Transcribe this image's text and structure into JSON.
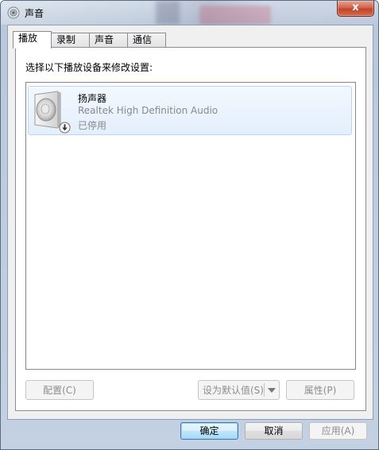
{
  "window": {
    "title": "声音",
    "close_label": "x"
  },
  "tabs": [
    {
      "label": "播放",
      "active": true
    },
    {
      "label": "录制",
      "active": false
    },
    {
      "label": "声音",
      "active": false
    },
    {
      "label": "通信",
      "active": false
    }
  ],
  "playback": {
    "instruction": "选择以下播放设备来修改设置:",
    "devices": [
      {
        "name": "扬声器",
        "description": "Realtek High Definition Audio",
        "status": "已停用",
        "icon": "speaker-icon",
        "overlay_icon": "disabled-down-arrow-icon"
      }
    ],
    "buttons": {
      "configure": "配置(C)",
      "set_default": "设为默认值(S)",
      "properties": "属性(P)"
    }
  },
  "footer": {
    "ok": "确定",
    "cancel": "取消",
    "apply": "应用(A)"
  },
  "colors": {
    "selection_border": "#b8d6fb",
    "selection_fill": "#e3effc",
    "close_button": "#c2442a",
    "disabled_text": "#8d8d8d"
  }
}
